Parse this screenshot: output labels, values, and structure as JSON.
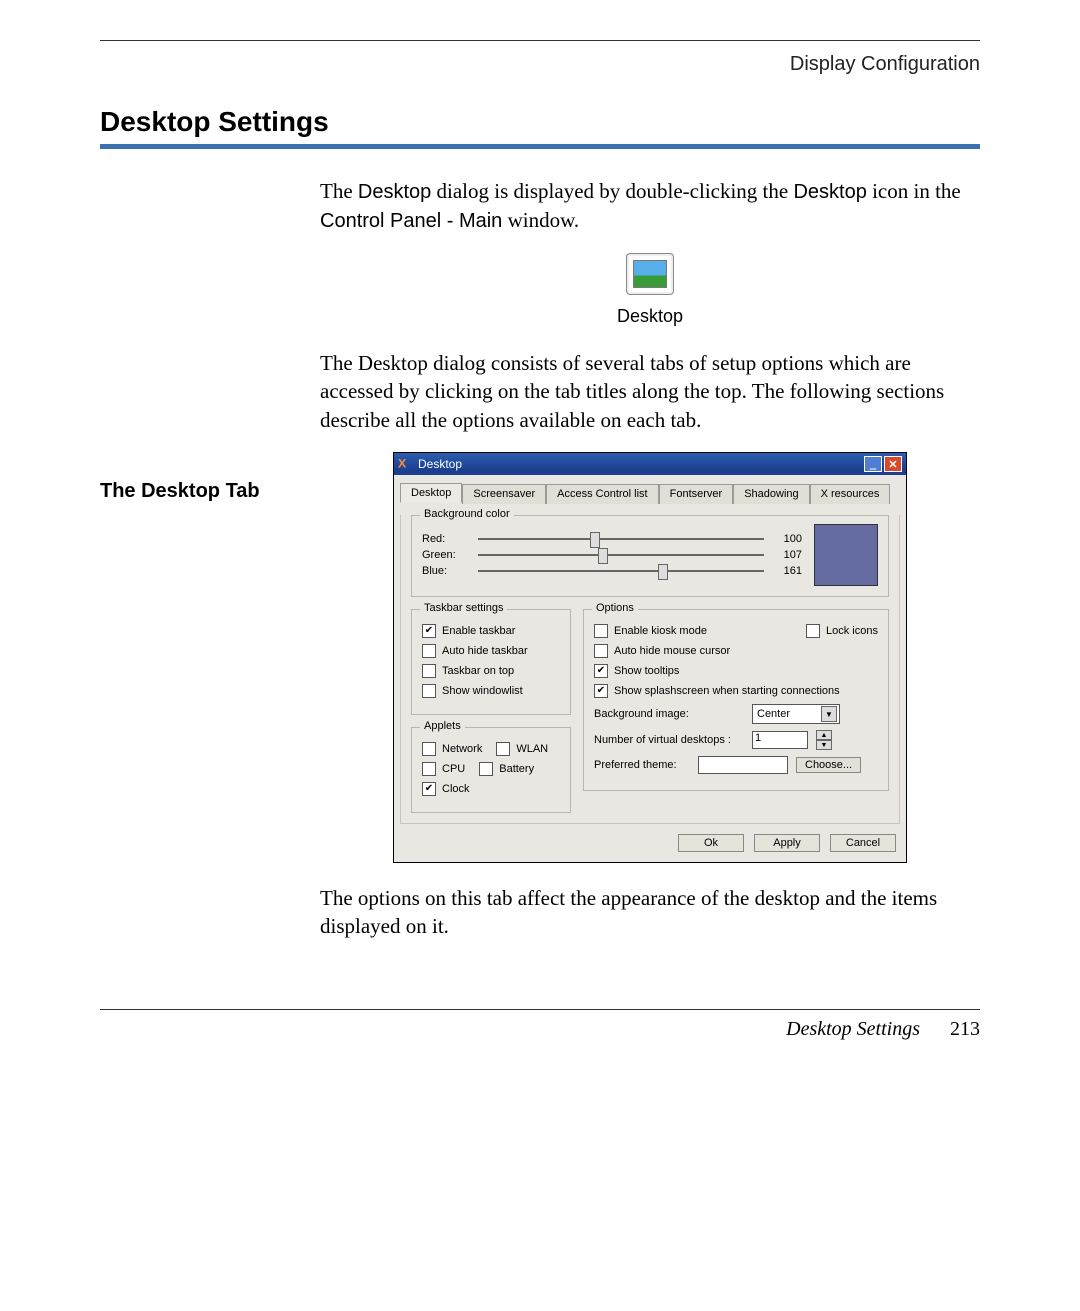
{
  "header": {
    "breadcrumb": "Display Configuration"
  },
  "title": "Desktop Settings",
  "intro": {
    "p1_a": "The ",
    "p1_code": "Desktop",
    "p1_b": " dialog is displayed by double-clicking the ",
    "p1_code2": "Desktop",
    "p1_c": " icon in the ",
    "p1_code3": "Control Panel - Main",
    "p1_d": " window."
  },
  "icon_caption": "Desktop",
  "para2": "The Desktop dialog consists of several tabs of setup options which are accessed by clicking on the tab titles along the top. The following sections describe all the options available on each tab.",
  "subhead": "The Desktop Tab",
  "dialog": {
    "window_title": "Desktop",
    "tabs": [
      "Desktop",
      "Screensaver",
      "Access Control list",
      "Fontserver",
      "Shadowing",
      "X resources"
    ],
    "bgcolor": {
      "group": "Background color",
      "red_label": "Red:",
      "red_value": "100",
      "green_label": "Green:",
      "green_value": "107",
      "blue_label": "Blue:",
      "blue_value": "161",
      "swatch": "#646ba1"
    },
    "taskbar": {
      "group": "Taskbar settings",
      "items": [
        {
          "label": "Enable taskbar",
          "checked": true
        },
        {
          "label": "Auto hide taskbar",
          "checked": false
        },
        {
          "label": "Taskbar on top",
          "checked": false
        },
        {
          "label": "Show windowlist",
          "checked": false
        }
      ]
    },
    "applets": {
      "group": "Applets",
      "row1a": "Network",
      "row1b": "WLAN",
      "row2a": "CPU",
      "row2b": "Battery",
      "row3a": "Clock"
    },
    "options": {
      "group": "Options",
      "enable_kiosk": "Enable kiosk mode",
      "lock_icons": "Lock icons",
      "auto_hide_cursor": "Auto hide mouse cursor",
      "show_tooltips": "Show tooltips",
      "show_splash": "Show splashscreen when starting connections",
      "bg_image_label": "Background image:",
      "bg_image_value": "Center",
      "num_desktops_label": "Number of virtual desktops :",
      "num_desktops_value": "1",
      "theme_label": "Preferred theme:",
      "choose_btn": "Choose..."
    },
    "buttons": {
      "ok": "Ok",
      "apply": "Apply",
      "cancel": "Cancel"
    }
  },
  "after": "The options on this tab affect the appearance of the desktop and the items displayed on it.",
  "footer": {
    "section": "Desktop Settings",
    "page": "213"
  }
}
